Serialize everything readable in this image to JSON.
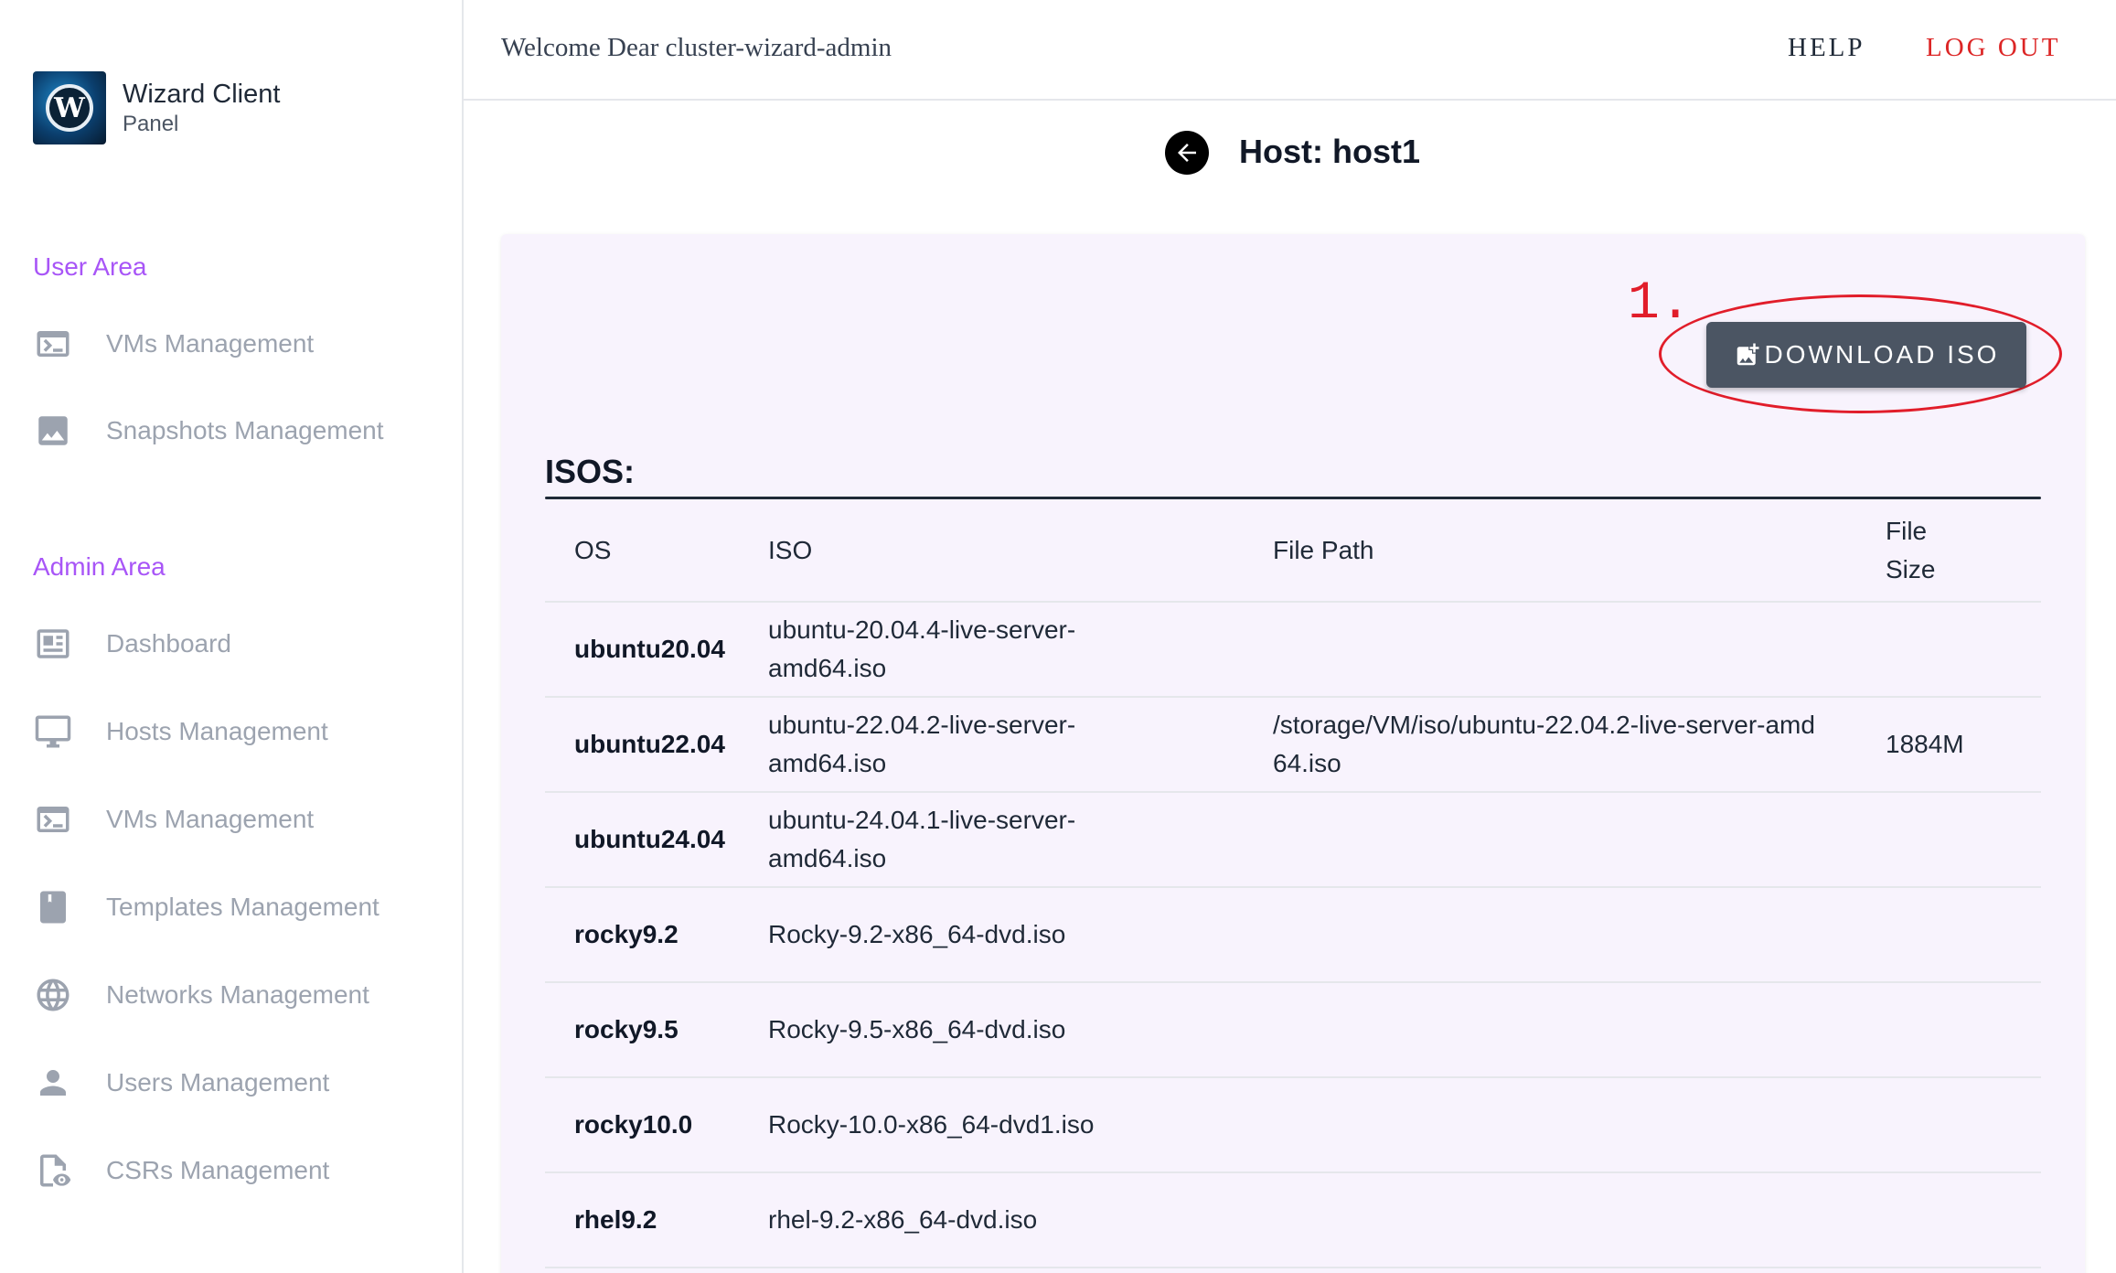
{
  "brand": {
    "name": "Wizard Client",
    "subtitle": "Panel",
    "logo_letter": "W"
  },
  "sidebar": {
    "user_area_title": "User Area",
    "user_items": [
      {
        "label": "VMs Management",
        "icon": "terminal-icon"
      },
      {
        "label": "Snapshots Management",
        "icon": "image-icon"
      }
    ],
    "admin_area_title": "Admin Area",
    "admin_items": [
      {
        "label": "Dashboard",
        "icon": "dashboard-icon"
      },
      {
        "label": "Hosts Management",
        "icon": "monitor-icon"
      },
      {
        "label": "VMs Management",
        "icon": "terminal-icon"
      },
      {
        "label": "Templates Management",
        "icon": "bookmark-icon"
      },
      {
        "label": "Networks Management",
        "icon": "globe-icon"
      },
      {
        "label": "Users Management",
        "icon": "user-icon"
      },
      {
        "label": "CSRs Management",
        "icon": "file-eye-icon"
      }
    ]
  },
  "topbar": {
    "welcome": "Welcome Dear cluster-wizard-admin",
    "help": "HELP",
    "logout": "LOG OUT"
  },
  "page": {
    "title": "Host: host1"
  },
  "actions": {
    "download_iso": "DOWNLOAD ISO"
  },
  "annotation": {
    "label": "1."
  },
  "isos": {
    "title": "ISOS:",
    "columns": [
      "OS",
      "ISO",
      "File Path",
      "File Size"
    ],
    "rows": [
      {
        "os": "ubuntu20.04",
        "iso": "ubuntu-20.04.4-live-server-amd64.iso",
        "path": "",
        "size": ""
      },
      {
        "os": "ubuntu22.04",
        "iso": "ubuntu-22.04.2-live-server-amd64.iso",
        "path": "/storage/VM/iso/ubuntu-22.04.2-live-server-amd64.iso",
        "size": "1884M"
      },
      {
        "os": "ubuntu24.04",
        "iso": "ubuntu-24.04.1-live-server-amd64.iso",
        "path": "",
        "size": ""
      },
      {
        "os": "rocky9.2",
        "iso": "Rocky-9.2-x86_64-dvd.iso",
        "path": "",
        "size": ""
      },
      {
        "os": "rocky9.5",
        "iso": "Rocky-9.5-x86_64-dvd.iso",
        "path": "",
        "size": ""
      },
      {
        "os": "rocky10.0",
        "iso": "Rocky-10.0-x86_64-dvd1.iso",
        "path": "",
        "size": ""
      },
      {
        "os": "rhel9.2",
        "iso": "rhel-9.2-x86_64-dvd.iso",
        "path": "",
        "size": ""
      }
    ]
  },
  "colors": {
    "accent_purple": "#a855f7",
    "logout_red": "#dc2626",
    "annotation_red": "#e11d2a",
    "button_gray": "#4b5563",
    "card_bg": "#f8f3fd"
  }
}
